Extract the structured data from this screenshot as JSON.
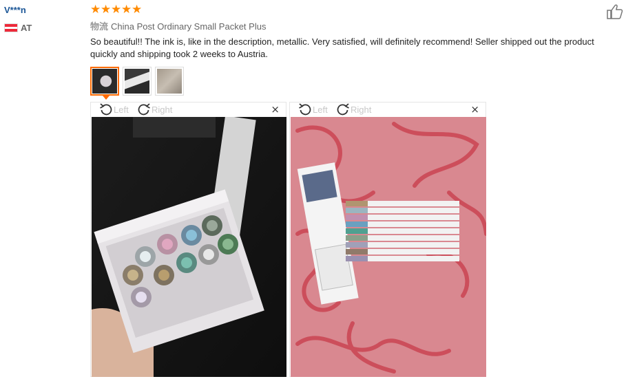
{
  "reviewer": {
    "name": "V***n",
    "country_code": "AT"
  },
  "rating": {
    "stars": 5,
    "star_glyph": "★",
    "color": "#ff8a00"
  },
  "logistics": {
    "label": "物流",
    "value": "China Post Ordinary Small Packet Plus"
  },
  "review_text": "So beautiful!! The ink is, like in the description, metallic. Very satisfied, will definitely recommend! Seller shipped out the product quickly and shipping took 2 weeks to Austria.",
  "thumbnails": [
    {
      "name": "photo-1",
      "active": true
    },
    {
      "name": "photo-2",
      "active": false
    },
    {
      "name": "photo-3",
      "active": false
    }
  ],
  "viewers": [
    {
      "rotate_left": "Left",
      "rotate_right": "Right",
      "close": "×"
    },
    {
      "rotate_left": "Left",
      "rotate_right": "Right",
      "close": "×"
    }
  ],
  "icons": {
    "like": "thumbs-up-icon",
    "rotate_left": "rotate-left-icon",
    "rotate_right": "rotate-right-icon",
    "close": "close-icon",
    "flag": "austria-flag-icon"
  },
  "colors": {
    "accent": "#ff6a00",
    "username": "#1a5596",
    "flag_red": "#ed2939"
  }
}
